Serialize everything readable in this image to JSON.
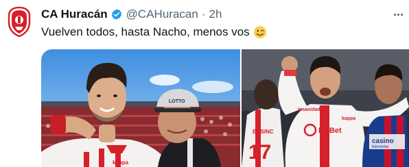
{
  "tweet": {
    "account_name": "CA Huracán",
    "handle": "@CAHuracan",
    "separator": "·",
    "timestamp": "2h",
    "text": "Vuelven todos, hasta Nacho, menos vos",
    "emoji": "winking-face"
  },
  "photo1": {
    "cap_brand": "LOTTO",
    "shirt_brand": "kappa"
  },
  "photo2": {
    "back_name": "BUSINC",
    "back_number": "17",
    "sponsor_top": "Iosanidad",
    "sponsor_main": "Mr.Bet",
    "shirt_brand": "kappa",
    "opponent_sponsor": "casino",
    "opponent_sponsor_sub": "bienestar"
  },
  "colors": {
    "verified_blue": "#1d9bf0",
    "secondary_text": "#536471",
    "huracan_red": "#d6202a",
    "opponent_blue": "#1a3c8c"
  }
}
